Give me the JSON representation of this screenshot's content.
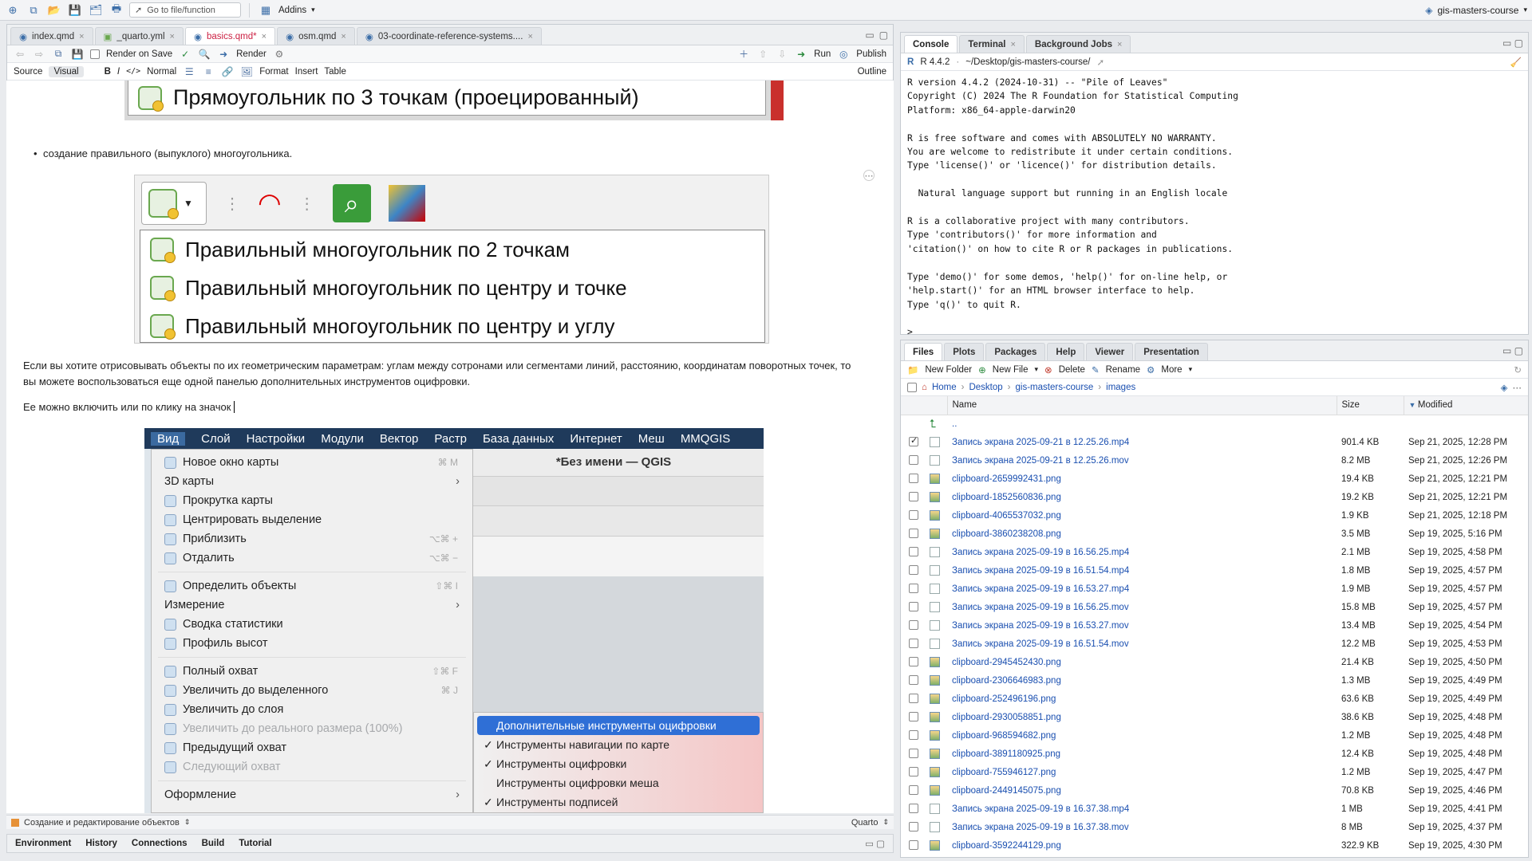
{
  "topbar": {
    "goto_placeholder": "Go to file/function",
    "addins": "Addins",
    "project": "gis-masters-course"
  },
  "editor": {
    "tabs": [
      {
        "label": "index.qmd",
        "modified": false
      },
      {
        "label": "_quarto.yml",
        "modified": false
      },
      {
        "label": "basics.qmd*",
        "modified": true
      },
      {
        "label": "osm.qmd",
        "modified": false
      },
      {
        "label": "03-coordinate-reference-systems....",
        "modified": false
      }
    ],
    "render_on_save": "Render on Save",
    "render": "Render",
    "run": "Run",
    "publish": "Publish",
    "source": "Source",
    "visual": "Visual",
    "normal": "Normal",
    "format": "Format",
    "insert": "Insert",
    "table": "Table",
    "outline": "Outline"
  },
  "document": {
    "img1_title": "Прямоугольник по 3 точкам (проецированный)",
    "bullet": "создание правильного (выпуклого) многоугольника.",
    "img2_items": [
      "Правильный многоугольник по 2 точкам",
      "Правильный многоугольник по центру и точке",
      "Правильный многоугольник по центру и углу"
    ],
    "para1": "Если вы хотите отрисовывать объекты по их геометрическим параметрам: углам между сотронами или сегментами линий, расстоянию, координатам поворотных точек, то вы можете воспользоваться еще одной панелью дополнительных инструментов оцифровки.",
    "para2": "Ее можно включить или по клику на значок",
    "qgis_menubar": [
      "Вид",
      "Слой",
      "Настройки",
      "Модули",
      "Вектор",
      "Растр",
      "База данных",
      "Интернет",
      "Меш",
      "MMQGIS"
    ],
    "qgis_window_title": "*Без имени — QGIS",
    "qgis_menu": [
      {
        "label": "Новое окно карты",
        "shortcut": "⌘ M",
        "dim": false,
        "arrow": false
      },
      {
        "label": "3D карты",
        "shortcut": "",
        "dim": false,
        "arrow": true
      },
      {
        "label": "Прокрутка карты",
        "shortcut": "",
        "dim": false,
        "arrow": false
      },
      {
        "label": "Центрировать выделение",
        "shortcut": "",
        "dim": false,
        "arrow": false
      },
      {
        "label": "Приблизить",
        "shortcut": "⌥⌘ +",
        "dim": false,
        "arrow": false
      },
      {
        "label": "Отдалить",
        "shortcut": "⌥⌘ −",
        "dim": false,
        "arrow": false
      },
      {
        "sep": true
      },
      {
        "label": "Определить объекты",
        "shortcut": "⇧⌘ I",
        "dim": false,
        "arrow": false
      },
      {
        "label": "Измерение",
        "shortcut": "",
        "dim": false,
        "arrow": true
      },
      {
        "label": "Сводка статистики",
        "shortcut": "",
        "dim": false,
        "arrow": false
      },
      {
        "label": "Профиль высот",
        "shortcut": "",
        "dim": false,
        "arrow": false
      },
      {
        "sep": true
      },
      {
        "label": "Полный охват",
        "shortcut": "⇧⌘ F",
        "dim": false,
        "arrow": false
      },
      {
        "label": "Увеличить до выделенного",
        "shortcut": "⌘ J",
        "dim": false,
        "arrow": false
      },
      {
        "label": "Увеличить до слоя",
        "shortcut": "",
        "dim": false,
        "arrow": false
      },
      {
        "label": "Увеличить до реального размера (100%)",
        "shortcut": "",
        "dim": true,
        "arrow": false
      },
      {
        "label": "Предыдущий охват",
        "shortcut": "",
        "dim": false,
        "arrow": false
      },
      {
        "label": "Следующий охват",
        "shortcut": "",
        "dim": true,
        "arrow": false
      },
      {
        "sep": true
      },
      {
        "label": "Оформление",
        "shortcut": "",
        "dim": false,
        "arrow": true
      }
    ],
    "qgis_submenu": [
      {
        "label": "Дополнительные инструменты оцифровки",
        "checked": false,
        "highlight": true
      },
      {
        "label": "Инструменты навигации по карте",
        "checked": true,
        "highlight": false
      },
      {
        "label": "Инструменты оцифровки",
        "checked": true,
        "highlight": false
      },
      {
        "label": "Инструменты оцифровки меша",
        "checked": false,
        "highlight": false
      },
      {
        "label": "Инструменты подписей",
        "checked": true,
        "highlight": false
      }
    ]
  },
  "statusbar": {
    "section": "Создание и редактирование объектов",
    "mode": "Quarto"
  },
  "bottom_tabs": [
    "Environment",
    "History",
    "Connections",
    "Build",
    "Tutorial"
  ],
  "console": {
    "tabs": [
      "Console",
      "Terminal",
      "Background Jobs"
    ],
    "version": "R 4.4.2",
    "path": "~/Desktop/gis-masters-course/",
    "text": "R version 4.4.2 (2024-10-31) -- \"Pile of Leaves\"\nCopyright (C) 2024 The R Foundation for Statistical Computing\nPlatform: x86_64-apple-darwin20\n\nR is free software and comes with ABSOLUTELY NO WARRANTY.\nYou are welcome to redistribute it under certain conditions.\nType 'license()' or 'licence()' for distribution details.\n\n  Natural language support but running in an English locale\n\nR is a collaborative project with many contributors.\nType 'contributors()' for more information and\n'citation()' on how to cite R or R packages in publications.\n\nType 'demo()' for some demos, 'help()' for on-line help, or\n'help.start()' for an HTML browser interface to help.\nType 'q()' to quit R.\n\n> "
  },
  "files": {
    "tabs": [
      "Files",
      "Plots",
      "Packages",
      "Help",
      "Viewer",
      "Presentation"
    ],
    "toolbar": {
      "new_folder": "New Folder",
      "new_file": "New File",
      "delete": "Delete",
      "rename": "Rename",
      "more": "More"
    },
    "breadcrumb": [
      "Home",
      "Desktop",
      "gis-masters-course",
      "images"
    ],
    "columns": {
      "name": "Name",
      "size": "Size",
      "modified": "Modified"
    },
    "up": "..",
    "rows": [
      {
        "name": "Запись экрана 2025-09-21 в 12.25.26.mp4",
        "size": "901.4 KB",
        "modified": "Sep 21, 2025, 12:28 PM",
        "img": false,
        "checked": true
      },
      {
        "name": "Запись экрана 2025-09-21 в 12.25.26.mov",
        "size": "8.2 MB",
        "modified": "Sep 21, 2025, 12:26 PM",
        "img": false,
        "checked": false
      },
      {
        "name": "clipboard-2659992431.png",
        "size": "19.4 KB",
        "modified": "Sep 21, 2025, 12:21 PM",
        "img": true,
        "checked": false
      },
      {
        "name": "clipboard-1852560836.png",
        "size": "19.2 KB",
        "modified": "Sep 21, 2025, 12:21 PM",
        "img": true,
        "checked": false
      },
      {
        "name": "clipboard-4065537032.png",
        "size": "1.9 KB",
        "modified": "Sep 21, 2025, 12:18 PM",
        "img": true,
        "checked": false
      },
      {
        "name": "clipboard-3860238208.png",
        "size": "3.5 MB",
        "modified": "Sep 19, 2025, 5:16 PM",
        "img": true,
        "checked": false
      },
      {
        "name": "Запись экрана 2025-09-19 в 16.56.25.mp4",
        "size": "2.1 MB",
        "modified": "Sep 19, 2025, 4:58 PM",
        "img": false,
        "checked": false
      },
      {
        "name": "Запись экрана 2025-09-19 в 16.51.54.mp4",
        "size": "1.8 MB",
        "modified": "Sep 19, 2025, 4:57 PM",
        "img": false,
        "checked": false
      },
      {
        "name": "Запись экрана 2025-09-19 в 16.53.27.mp4",
        "size": "1.9 MB",
        "modified": "Sep 19, 2025, 4:57 PM",
        "img": false,
        "checked": false
      },
      {
        "name": "Запись экрана 2025-09-19 в 16.56.25.mov",
        "size": "15.8 MB",
        "modified": "Sep 19, 2025, 4:57 PM",
        "img": false,
        "checked": false
      },
      {
        "name": "Запись экрана 2025-09-19 в 16.53.27.mov",
        "size": "13.4 MB",
        "modified": "Sep 19, 2025, 4:54 PM",
        "img": false,
        "checked": false
      },
      {
        "name": "Запись экрана 2025-09-19 в 16.51.54.mov",
        "size": "12.2 MB",
        "modified": "Sep 19, 2025, 4:53 PM",
        "img": false,
        "checked": false
      },
      {
        "name": "clipboard-2945452430.png",
        "size": "21.4 KB",
        "modified": "Sep 19, 2025, 4:50 PM",
        "img": true,
        "checked": false
      },
      {
        "name": "clipboard-2306646983.png",
        "size": "1.3 MB",
        "modified": "Sep 19, 2025, 4:49 PM",
        "img": true,
        "checked": false
      },
      {
        "name": "clipboard-252496196.png",
        "size": "63.6 KB",
        "modified": "Sep 19, 2025, 4:49 PM",
        "img": true,
        "checked": false
      },
      {
        "name": "clipboard-2930058851.png",
        "size": "38.6 KB",
        "modified": "Sep 19, 2025, 4:48 PM",
        "img": true,
        "checked": false
      },
      {
        "name": "clipboard-968594682.png",
        "size": "1.2 MB",
        "modified": "Sep 19, 2025, 4:48 PM",
        "img": true,
        "checked": false
      },
      {
        "name": "clipboard-3891180925.png",
        "size": "12.4 KB",
        "modified": "Sep 19, 2025, 4:48 PM",
        "img": true,
        "checked": false
      },
      {
        "name": "clipboard-755946127.png",
        "size": "1.2 MB",
        "modified": "Sep 19, 2025, 4:47 PM",
        "img": true,
        "checked": false
      },
      {
        "name": "clipboard-2449145075.png",
        "size": "70.8 KB",
        "modified": "Sep 19, 2025, 4:46 PM",
        "img": true,
        "checked": false
      },
      {
        "name": "Запись экрана 2025-09-19 в 16.37.38.mp4",
        "size": "1 MB",
        "modified": "Sep 19, 2025, 4:41 PM",
        "img": false,
        "checked": false
      },
      {
        "name": "Запись экрана 2025-09-19 в 16.37.38.mov",
        "size": "8 MB",
        "modified": "Sep 19, 2025, 4:37 PM",
        "img": false,
        "checked": false
      },
      {
        "name": "clipboard-3592244129.png",
        "size": "322.9 KB",
        "modified": "Sep 19, 2025, 4:30 PM",
        "img": true,
        "checked": false
      }
    ]
  }
}
